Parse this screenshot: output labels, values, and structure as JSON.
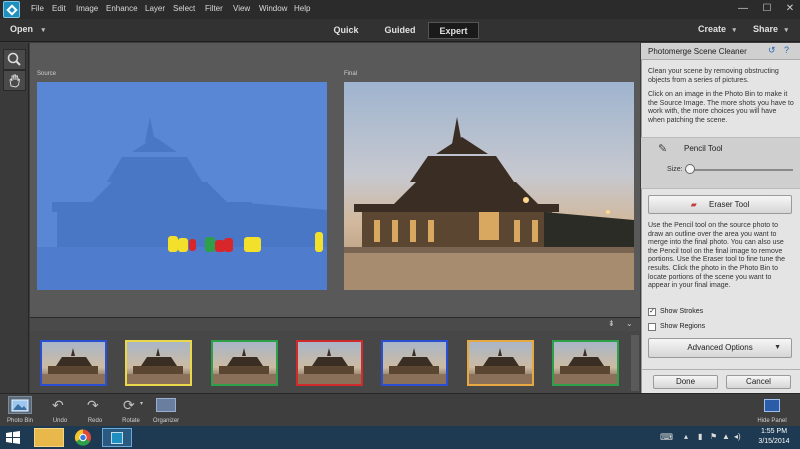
{
  "menu": [
    "File",
    "Edit",
    "Image",
    "Enhance",
    "Layer",
    "Select",
    "Filter",
    "View",
    "Window",
    "Help"
  ],
  "window_controls": {
    "minimize": "—",
    "maximize": "☐",
    "close": "✕"
  },
  "modebar": {
    "open": "Open",
    "modes": [
      "Quick",
      "Guided",
      "Expert"
    ],
    "active_mode": "Expert",
    "create": "Create",
    "share": "Share"
  },
  "canvas": {
    "source_label": "Source",
    "final_label": "Final"
  },
  "panel": {
    "title": "Photomerge Scene Cleaner",
    "intro": "Clean your scene by removing obstructing objects from a series of pictures.",
    "instructions": "Click on an image in the Photo Bin to make it the Source Image. The more shots you have to work with, the more choices you will have when patching the scene.",
    "pencil_tool": "Pencil Tool",
    "size_label": "Size:",
    "eraser_tool": "Eraser Tool",
    "help_text": "Use the Pencil tool on the source photo to draw an outline over the area you want to merge into the final photo. You can also use the Pencil tool on the final image to remove portions. Use the Eraser tool to fine tune the results. Click the photo in the Photo Bin to locate portions of the scene you want to appear in your final image.",
    "show_strokes": "Show Strokes",
    "show_strokes_checked": true,
    "show_regions": "Show Regions",
    "show_regions_checked": false,
    "advanced_options": "Advanced Options",
    "done": "Done",
    "cancel": "Cancel"
  },
  "thumbnails": [
    {
      "border": "#2a4fd0"
    },
    {
      "border": "#e8d84a"
    },
    {
      "border": "#2ea04a"
    },
    {
      "border": "#d02a2a"
    },
    {
      "border": "#2a4fd0"
    },
    {
      "border": "#e6a840"
    },
    {
      "border": "#2ea04a"
    }
  ],
  "bottom_toolbar": {
    "photo_bin": "Photo Bin",
    "undo": "Undo",
    "redo": "Redo",
    "rotate": "Rotate",
    "organizer": "Organizer",
    "hide_panel": "Hide Panel"
  },
  "taskbar": {
    "time": "1:55 PM",
    "date": "3/15/2014"
  },
  "colors": {
    "source_overlay": "#5a86d6",
    "stroke_yellow": "#f2e02a",
    "stroke_red": "#d8262a",
    "stroke_green": "#2ea04a"
  }
}
